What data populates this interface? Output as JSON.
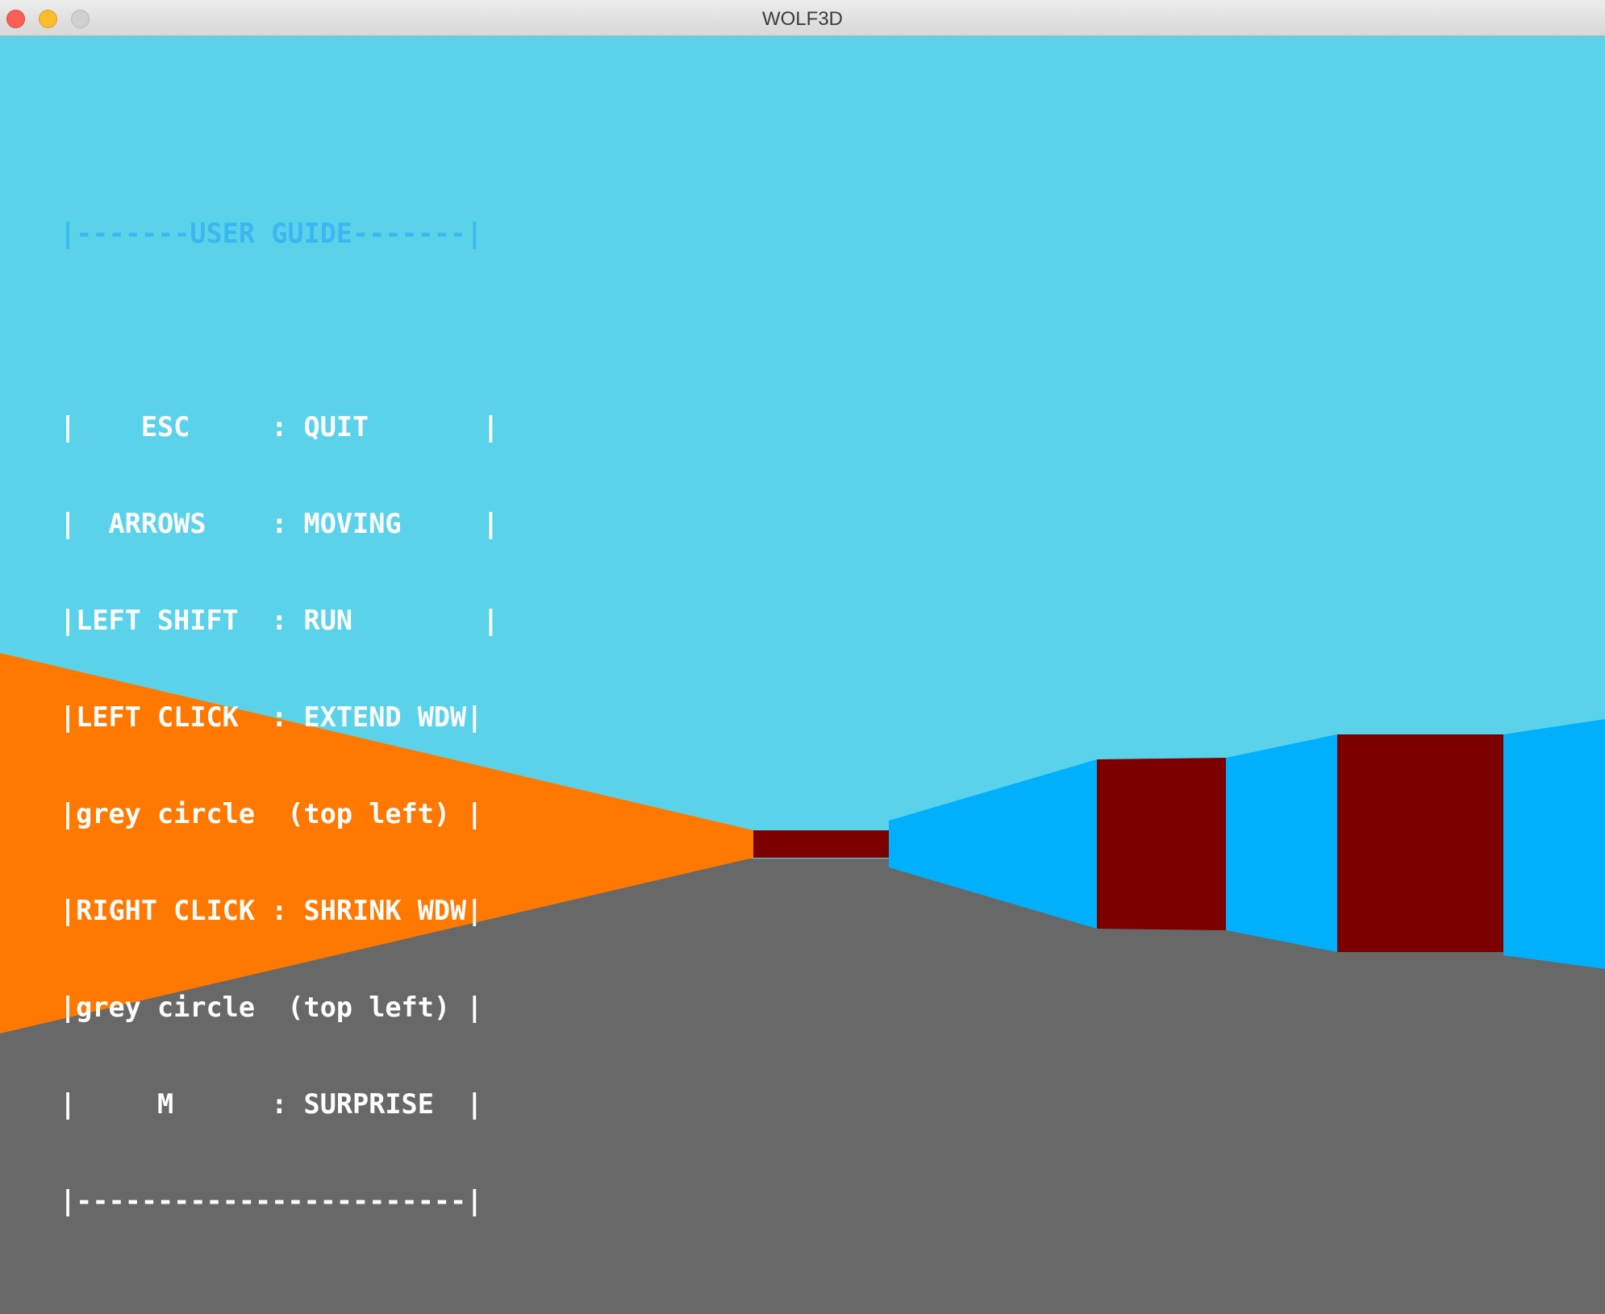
{
  "window": {
    "title": "WOLF3D",
    "controls": [
      "close",
      "minimize",
      "zoom"
    ]
  },
  "scene": {
    "colors": {
      "sky": "#5ad3ea",
      "floor": "#686868",
      "orange_wall": "#ff7800",
      "blue_wall": "#00b0fb",
      "dark_red_wall": "#7d0000"
    }
  },
  "user_guide": {
    "header": "|-------USER GUIDE-------|",
    "lines": [
      "|    ESC     : QUIT       |",
      "|  ARROWS    : MOVING     |",
      "|LEFT SHIFT  : RUN        |",
      "|LEFT CLICK  : EXTEND WDW|",
      "|grey circle  (top left) |",
      "|RIGHT CLICK : SHRINK WDW|",
      "|grey circle  (top left) |",
      "|     M      : SURPRISE  |",
      "|------------------------|"
    ],
    "header_color": "#3ab7f0",
    "text_color": "#ffffff"
  }
}
